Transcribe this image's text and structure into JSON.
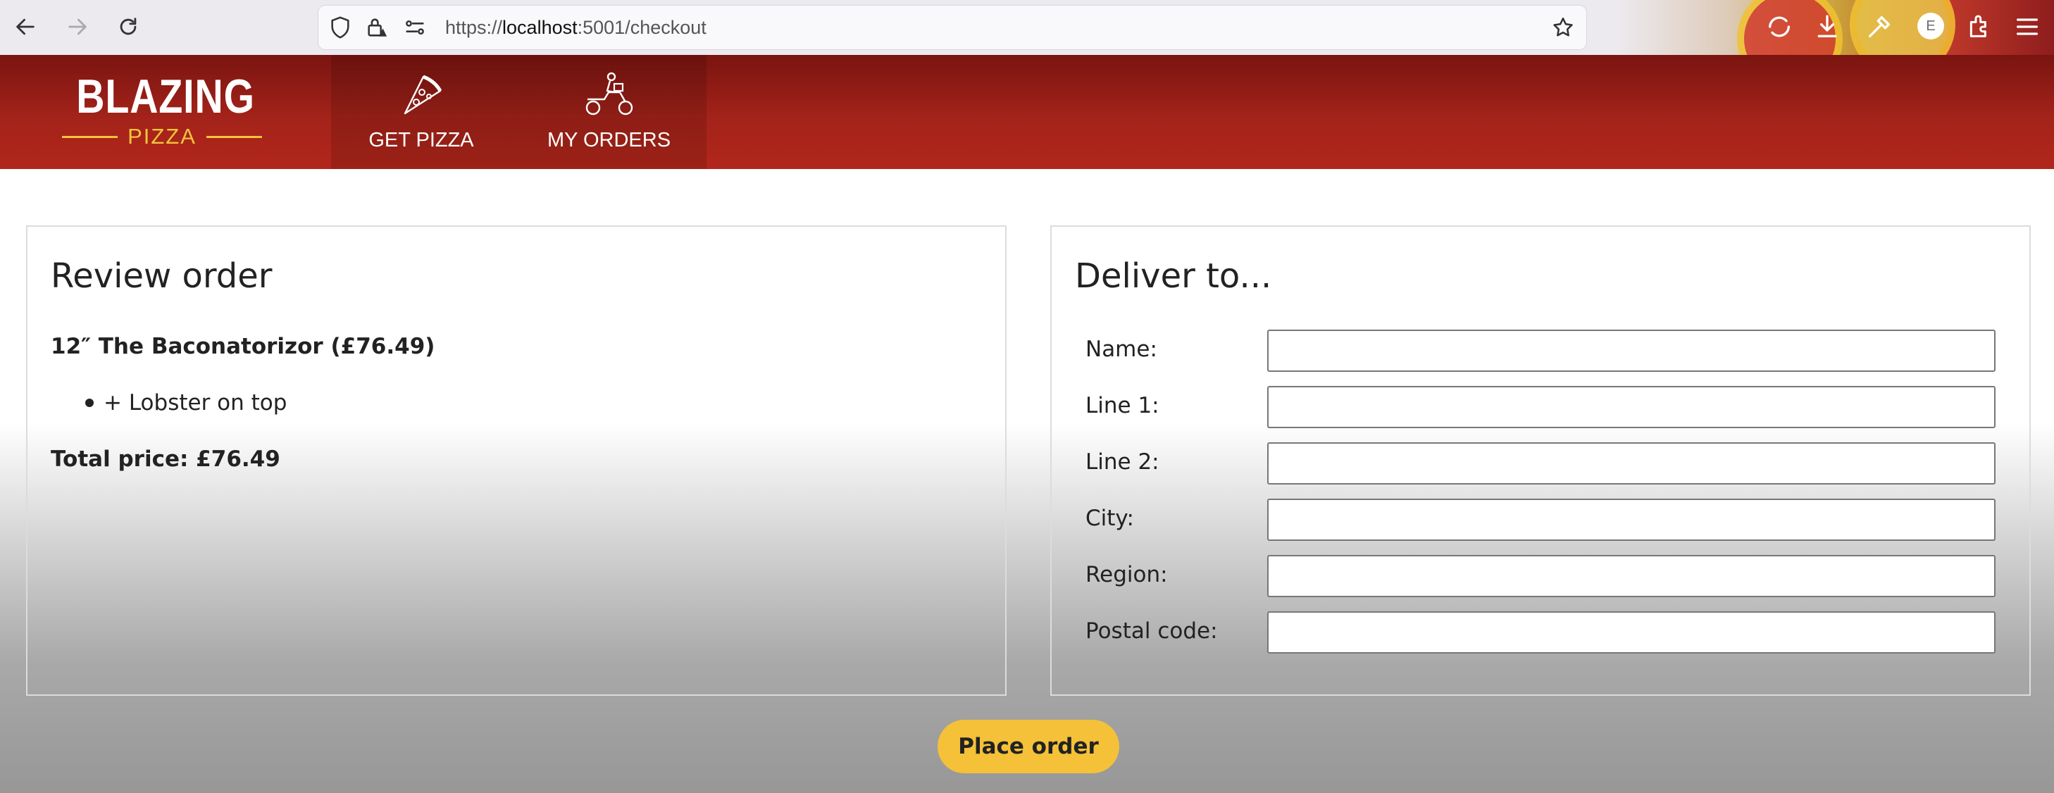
{
  "browser": {
    "url_prefix": "https://",
    "url_host": "localhost",
    "url_rest": ":5001/checkout",
    "profile_initial": "E",
    "icons": [
      "back-icon",
      "forward-icon",
      "reload-icon",
      "shield-icon",
      "lock-warning-icon",
      "permissions-icon",
      "bookmark-star-icon",
      "sync-icon",
      "download-icon",
      "tools-icon",
      "extensions-icon",
      "menu-icon"
    ]
  },
  "header": {
    "brand_title": "BLAZING",
    "brand_subtitle": "PIZZA",
    "nav": {
      "get_pizza": "GET PIZZA",
      "my_orders": "MY ORDERS"
    }
  },
  "review": {
    "heading": "Review order",
    "pizza": "12″ The Baconatorizor (£76.49)",
    "toppings": [
      "+ Lobster on top"
    ],
    "total": "Total price: £76.49"
  },
  "deliver": {
    "heading": "Deliver to...",
    "fields": {
      "name": {
        "label": "Name:",
        "value": ""
      },
      "line1": {
        "label": "Line 1:",
        "value": ""
      },
      "line2": {
        "label": "Line 2:",
        "value": ""
      },
      "city": {
        "label": "City:",
        "value": ""
      },
      "region": {
        "label": "Region:",
        "value": ""
      },
      "postal": {
        "label": "Postal code:",
        "value": ""
      }
    }
  },
  "actions": {
    "place_order": "Place order"
  },
  "colors": {
    "header_red": "#a3231a",
    "brand_gold": "#f3c43d",
    "button_yellow": "#f4c138"
  }
}
